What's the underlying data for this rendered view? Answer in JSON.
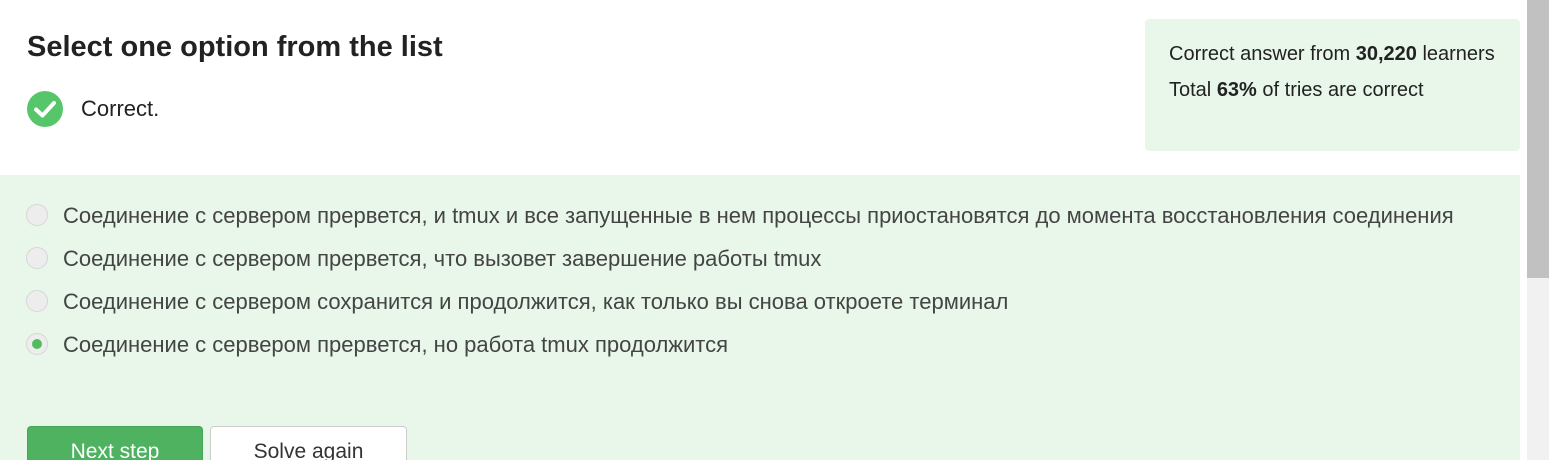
{
  "question": {
    "title": "Select one option from the list"
  },
  "feedback": {
    "icon": "checkmark-icon",
    "text": "Correct.",
    "color": "#57c56a"
  },
  "stats": {
    "learners_prefix": "Correct answer from",
    "learners_count": "30,220",
    "learners_suffix": "learners",
    "tries_prefix": "Total",
    "tries_percent": "63%",
    "tries_suffix": "of tries are correct"
  },
  "options": [
    {
      "label": "Соединение с сервером прервется, и tmux и все запущенные в нем процессы приостановятся до момента восстановления соединения",
      "selected": false
    },
    {
      "label": "Соединение с сервером прервется, что вызовет завершение работы tmux",
      "selected": false
    },
    {
      "label": "Соединение с сервером сохранится и продолжится, как только вы снова откроете терминал",
      "selected": false
    },
    {
      "label": "Соединение с сервером прервется, но работа tmux продолжится",
      "selected": true
    }
  ],
  "actions": {
    "next_label": "Next step",
    "solve_again_label": "Solve again"
  },
  "colors": {
    "accent_green": "#4fb260",
    "answer_background": "#e8f7ea"
  }
}
